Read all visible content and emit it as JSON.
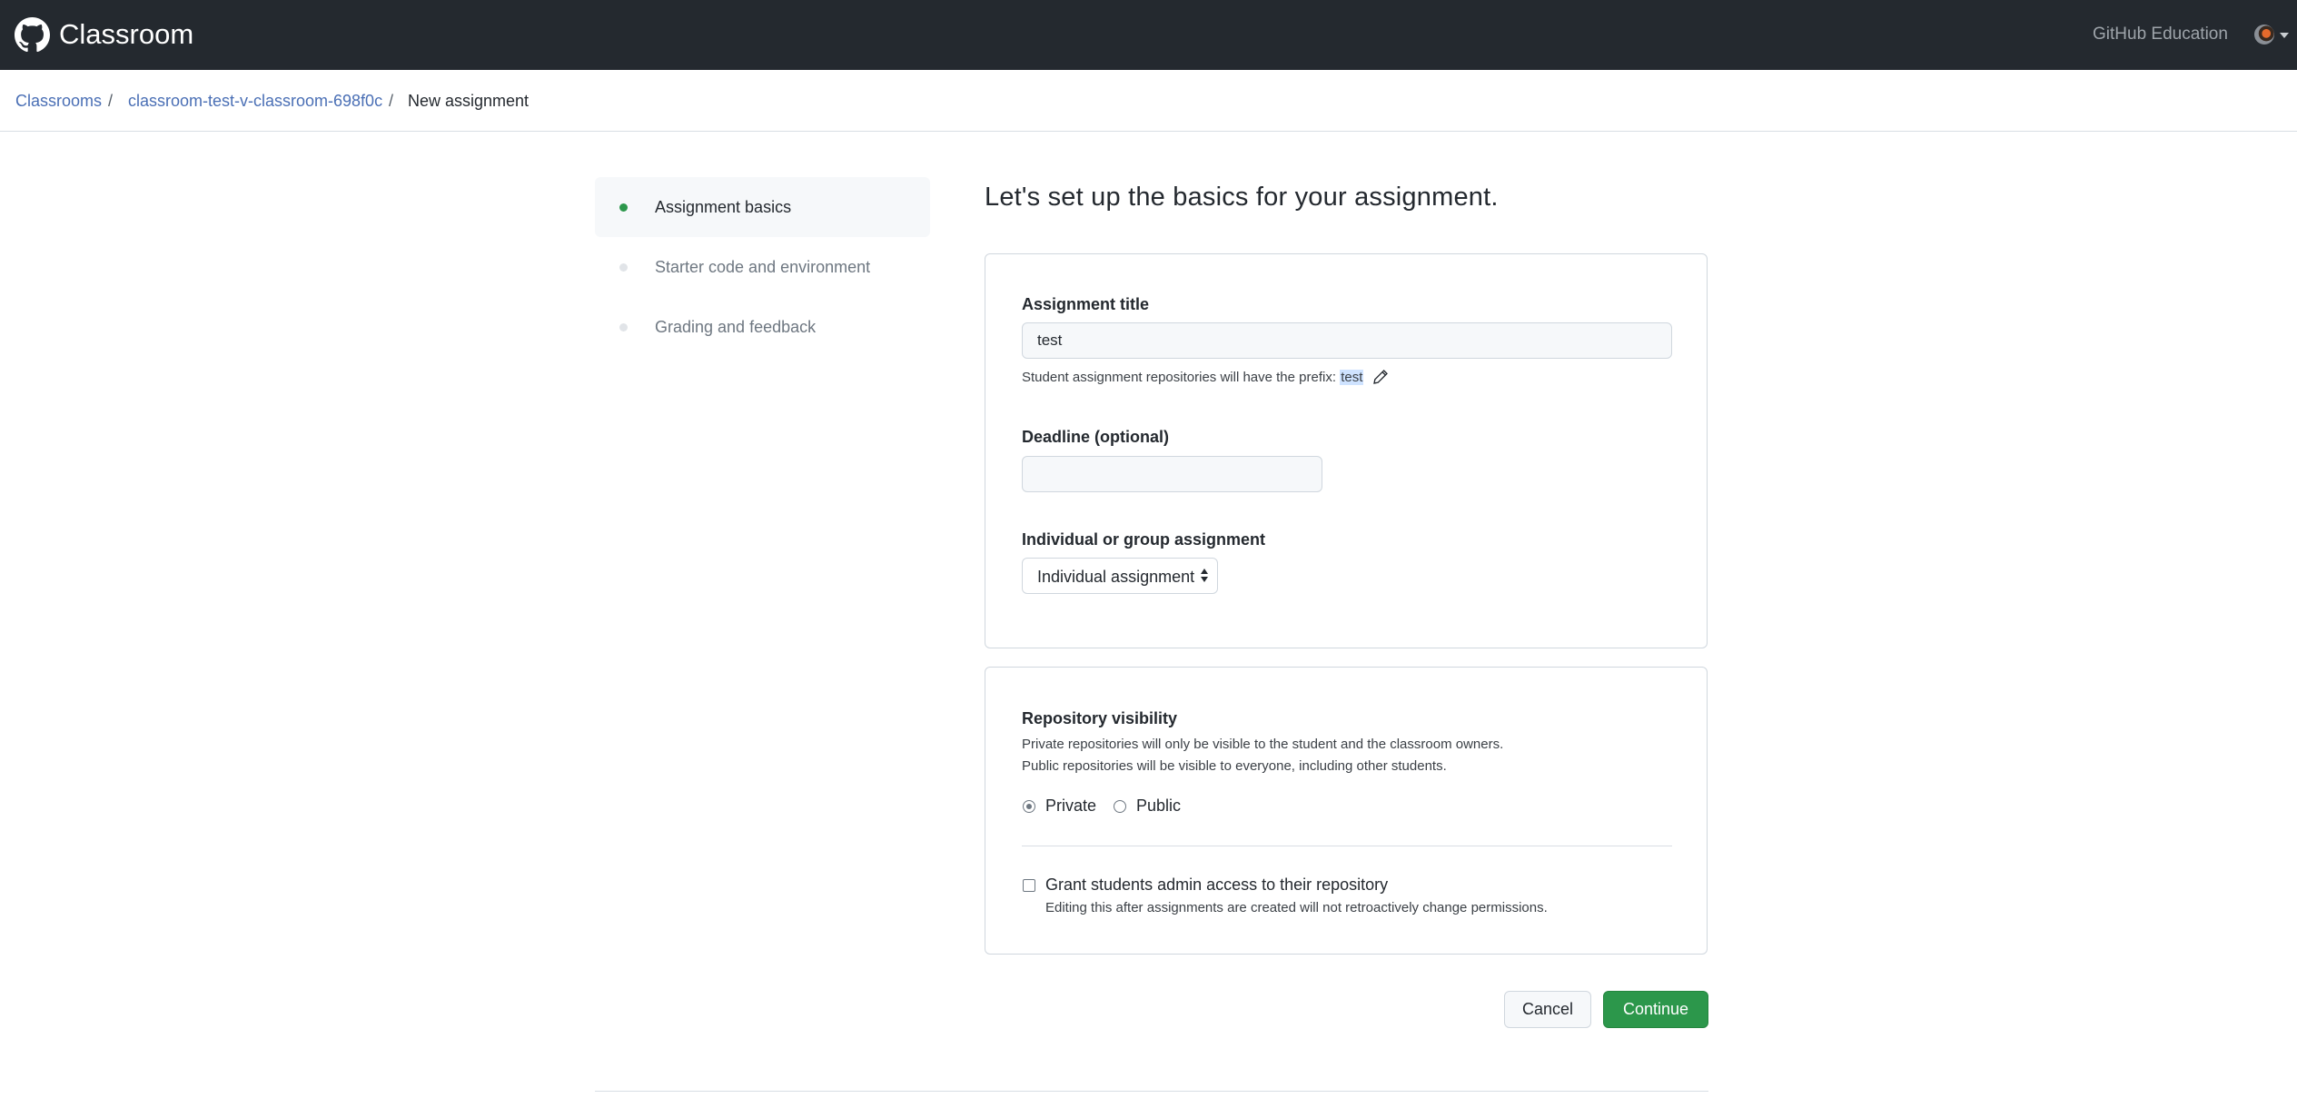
{
  "header": {
    "brand": "Classroom",
    "logo_icon": "github-octocat-icon",
    "right_link": "GitHub Education",
    "avatar_icon": "user-avatar"
  },
  "breadcrumb": {
    "items": [
      "Classrooms",
      "classroom-test-v-classroom-698f0c",
      "New assignment"
    ],
    "separator": "/"
  },
  "steps": [
    {
      "label": "Assignment basics",
      "active": true
    },
    {
      "label": "Starter code and environment",
      "active": false
    },
    {
      "label": "Grading and feedback",
      "active": false
    }
  ],
  "main": {
    "title": "Let's set up the basics for your assignment."
  },
  "basics": {
    "title_label": "Assignment title",
    "title_value": "test",
    "prefix_hint": "Student assignment repositories will have the prefix:",
    "prefix_value": "test",
    "deadline_label": "Deadline (optional)",
    "deadline_value": "",
    "group_label": "Individual or group assignment",
    "group_selected": "Individual assignment"
  },
  "visibility": {
    "label": "Repository visibility",
    "desc_line1": "Private repositories will only be visible to the student and the classroom owners.",
    "desc_line2": "Public repositories will be visible to everyone, including other students.",
    "options": [
      {
        "label": "Private",
        "checked": true
      },
      {
        "label": "Public",
        "checked": false
      }
    ],
    "admin_label": "Grant students admin access to their repository",
    "admin_hint": "Editing this after assignments are created will not retroactively change permissions.",
    "admin_checked": false
  },
  "actions": {
    "cancel": "Cancel",
    "continue": "Continue"
  },
  "colors": {
    "header_bg": "#24292f",
    "accent_green": "#2c974b",
    "link_blue": "#4a6fb5"
  }
}
